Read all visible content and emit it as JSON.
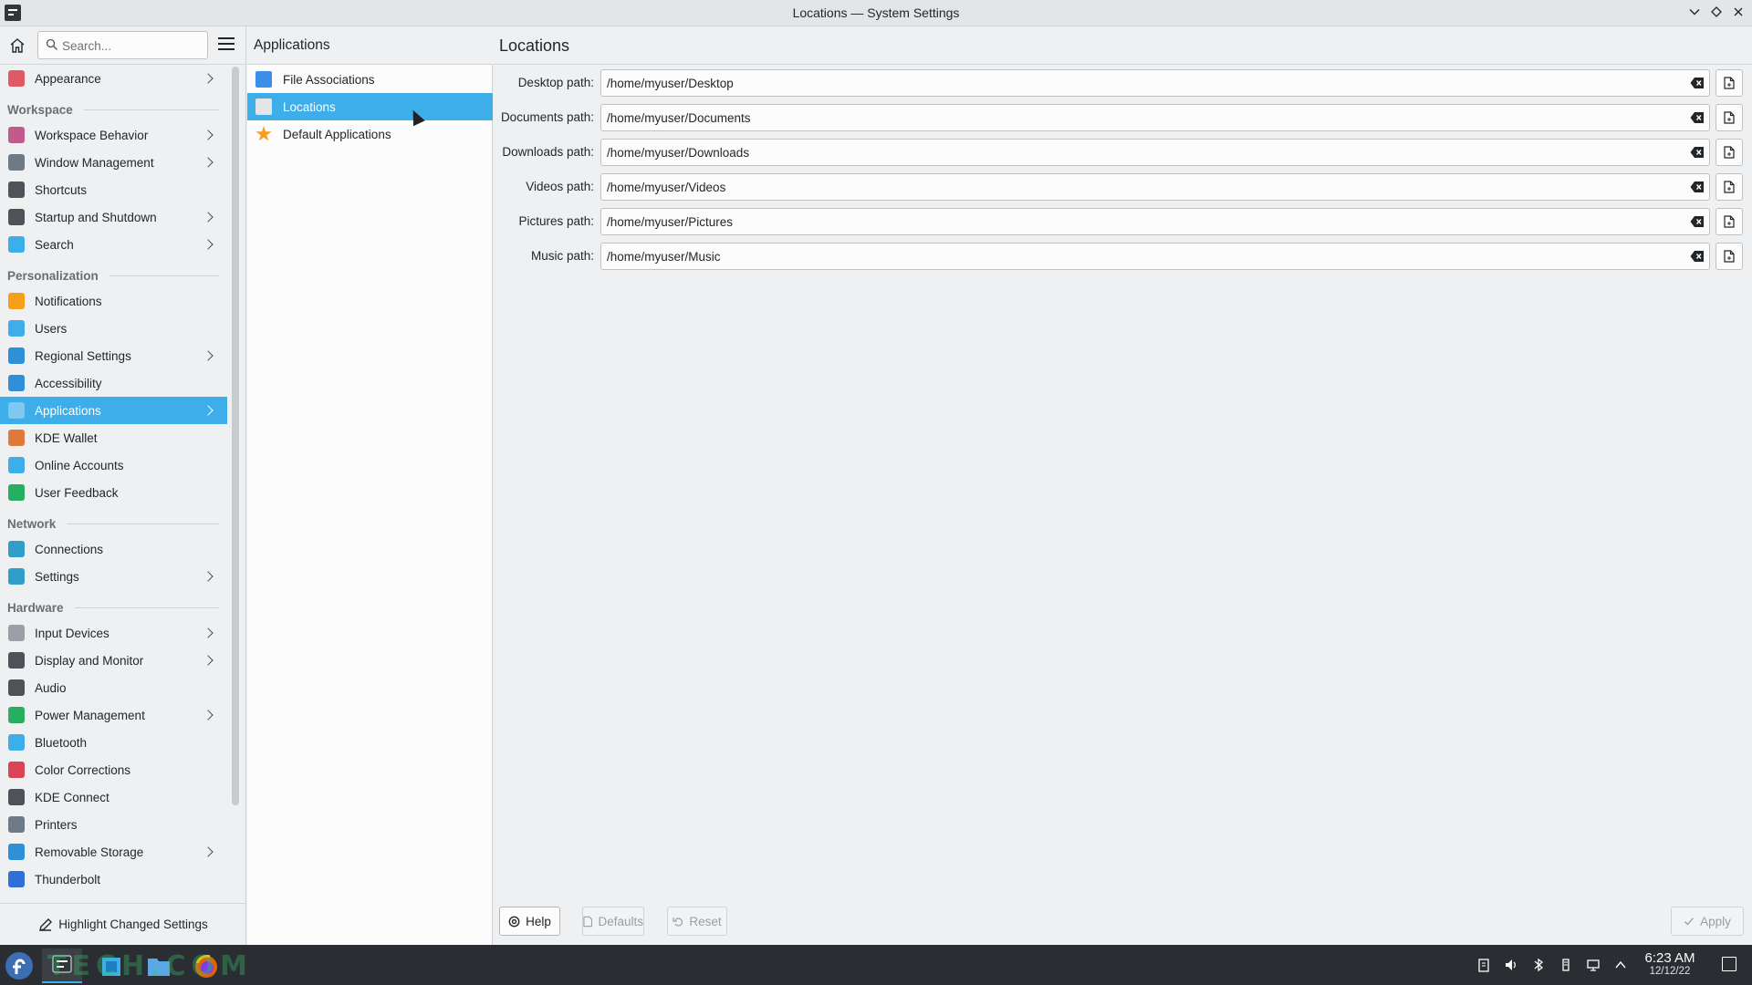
{
  "window": {
    "title": "Locations — System Settings"
  },
  "sidebar": {
    "search_placeholder": "Search...",
    "footer_label": "Highlight Changed Settings",
    "entries": [
      {
        "kind": "item",
        "label": "Appearance",
        "chevron": true,
        "icon": "appearance-icon",
        "color": "#e05a66"
      },
      {
        "kind": "cat",
        "label": "Workspace"
      },
      {
        "kind": "item",
        "label": "Workspace Behavior",
        "chevron": true,
        "icon": "workspace-behavior-icon",
        "color": "#c25a8e"
      },
      {
        "kind": "item",
        "label": "Window Management",
        "chevron": true,
        "icon": "window-management-icon",
        "color": "#6e7a86"
      },
      {
        "kind": "item",
        "label": "Shortcuts",
        "chevron": false,
        "icon": "keyboard-icon",
        "color": "#4d5358"
      },
      {
        "kind": "item",
        "label": "Startup and Shutdown",
        "chevron": true,
        "icon": "startup-icon",
        "color": "#4d5358"
      },
      {
        "kind": "item",
        "label": "Search",
        "chevron": true,
        "icon": "search-icon",
        "color": "#3daee9"
      },
      {
        "kind": "cat",
        "label": "Personalization"
      },
      {
        "kind": "item",
        "label": "Notifications",
        "chevron": false,
        "icon": "bell-icon",
        "color": "#f6a01a"
      },
      {
        "kind": "item",
        "label": "Users",
        "chevron": false,
        "icon": "users-icon",
        "color": "#3daee9"
      },
      {
        "kind": "item",
        "label": "Regional Settings",
        "chevron": true,
        "icon": "regional-icon",
        "color": "#2f8fd8"
      },
      {
        "kind": "item",
        "label": "Accessibility",
        "chevron": false,
        "icon": "accessibility-icon",
        "color": "#2f8fd8"
      },
      {
        "kind": "item",
        "label": "Applications",
        "chevron": true,
        "selected": true,
        "icon": "applications-icon",
        "color": "#7fc9f0"
      },
      {
        "kind": "item",
        "label": "KDE Wallet",
        "chevron": false,
        "icon": "wallet-icon",
        "color": "#e07a3a"
      },
      {
        "kind": "item",
        "label": "Online Accounts",
        "chevron": false,
        "icon": "online-accounts-icon",
        "color": "#3daee9"
      },
      {
        "kind": "item",
        "label": "User Feedback",
        "chevron": false,
        "icon": "feedback-icon",
        "color": "#27ae60"
      },
      {
        "kind": "cat",
        "label": "Network"
      },
      {
        "kind": "item",
        "label": "Connections",
        "chevron": false,
        "icon": "globe-icon",
        "color": "#2f9ec9"
      },
      {
        "kind": "item",
        "label": "Settings",
        "chevron": true,
        "icon": "network-settings-icon",
        "color": "#2f9ec9"
      },
      {
        "kind": "cat",
        "label": "Hardware"
      },
      {
        "kind": "item",
        "label": "Input Devices",
        "chevron": true,
        "icon": "mouse-icon",
        "color": "#9aa0a6"
      },
      {
        "kind": "item",
        "label": "Display and Monitor",
        "chevron": true,
        "icon": "monitor-icon",
        "color": "#4d5358"
      },
      {
        "kind": "item",
        "label": "Audio",
        "chevron": false,
        "icon": "speaker-icon",
        "color": "#4d5358"
      },
      {
        "kind": "item",
        "label": "Power Management",
        "chevron": true,
        "icon": "power-icon",
        "color": "#27ae60"
      },
      {
        "kind": "item",
        "label": "Bluetooth",
        "chevron": false,
        "icon": "bluetooth-icon",
        "color": "#3daee9"
      },
      {
        "kind": "item",
        "label": "Color Corrections",
        "chevron": false,
        "icon": "color-icon",
        "color": "#da4453"
      },
      {
        "kind": "item",
        "label": "KDE Connect",
        "chevron": false,
        "icon": "phone-icon",
        "color": "#4d5358"
      },
      {
        "kind": "item",
        "label": "Printers",
        "chevron": false,
        "icon": "printer-icon",
        "color": "#6e7a86"
      },
      {
        "kind": "item",
        "label": "Removable Storage",
        "chevron": true,
        "icon": "usb-icon",
        "color": "#2f8fd8"
      },
      {
        "kind": "item",
        "label": "Thunderbolt",
        "chevron": false,
        "icon": "thunderbolt-icon",
        "color": "#2f6fd8"
      }
    ]
  },
  "middle": {
    "title": "Applications",
    "items": [
      {
        "label": "File Associations",
        "icon": "file-associations-icon",
        "color": "#3d8ee9"
      },
      {
        "label": "Locations",
        "icon": "folder-icon",
        "color": "#e3e5e7",
        "selected": true
      },
      {
        "label": "Default Applications",
        "icon": "star-icon",
        "color": "#f6a01a"
      }
    ]
  },
  "main": {
    "title": "Locations",
    "paths": [
      {
        "label": "Desktop path:",
        "value": "/home/myuser/Desktop"
      },
      {
        "label": "Documents path:",
        "value": "/home/myuser/Documents"
      },
      {
        "label": "Downloads path:",
        "value": "/home/myuser/Downloads"
      },
      {
        "label": "Videos path:",
        "value": "/home/myuser/Videos"
      },
      {
        "label": "Pictures path:",
        "value": "/home/myuser/Pictures"
      },
      {
        "label": "Music path:",
        "value": "/home/myuser/Music"
      }
    ],
    "buttons": {
      "help": "Help",
      "defaults": "Defaults",
      "reset": "Reset",
      "apply": "Apply"
    }
  },
  "taskbar": {
    "watermark": "TECH.COM",
    "time": "6:23 AM",
    "date": "12/12/22"
  },
  "colors": {
    "accent": "#3daee9",
    "panel": "#2a2e32"
  }
}
